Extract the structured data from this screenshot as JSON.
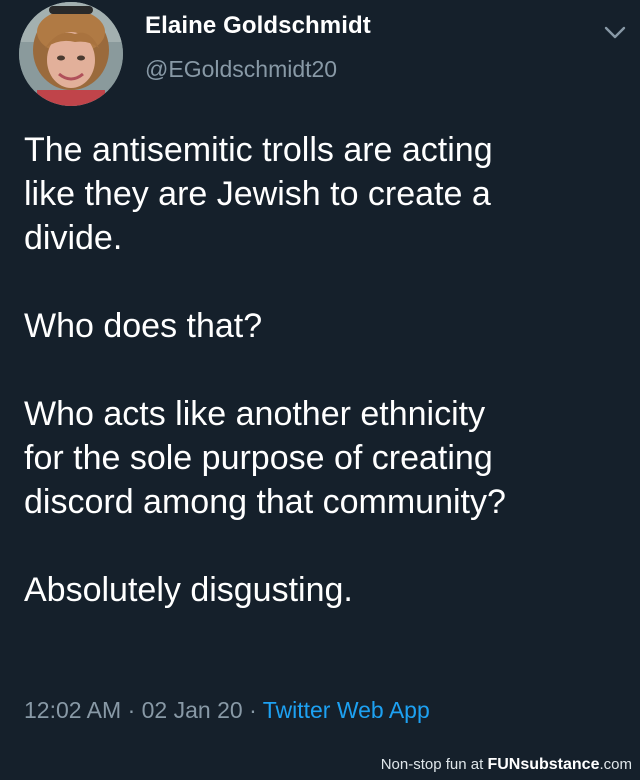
{
  "tweet": {
    "display_name": "Elaine Goldschmidt",
    "handle": "@EGoldschmidt20",
    "avatar_icon": "profile-photo",
    "menu_icon": "chevron-down-icon",
    "paragraphs": [
      "The antisemitic trolls are acting\nlike they are Jewish to create a\ndivide.",
      "Who does that?",
      "Who acts like another ethnicity\nfor the sole purpose of creating\ndiscord among that community?",
      "Absolutely disgusting."
    ],
    "time": "12:02 AM",
    "date": "02 Jan 20",
    "separator": "·",
    "source": "Twitter Web App"
  },
  "watermark": {
    "prefix": "Non-stop fun at ",
    "brand": "FUNsubstance",
    "suffix": ".com"
  },
  "colors": {
    "background": "#15202b",
    "text": "#ffffff",
    "secondary_text": "#8899a6",
    "link": "#1da1f2"
  }
}
